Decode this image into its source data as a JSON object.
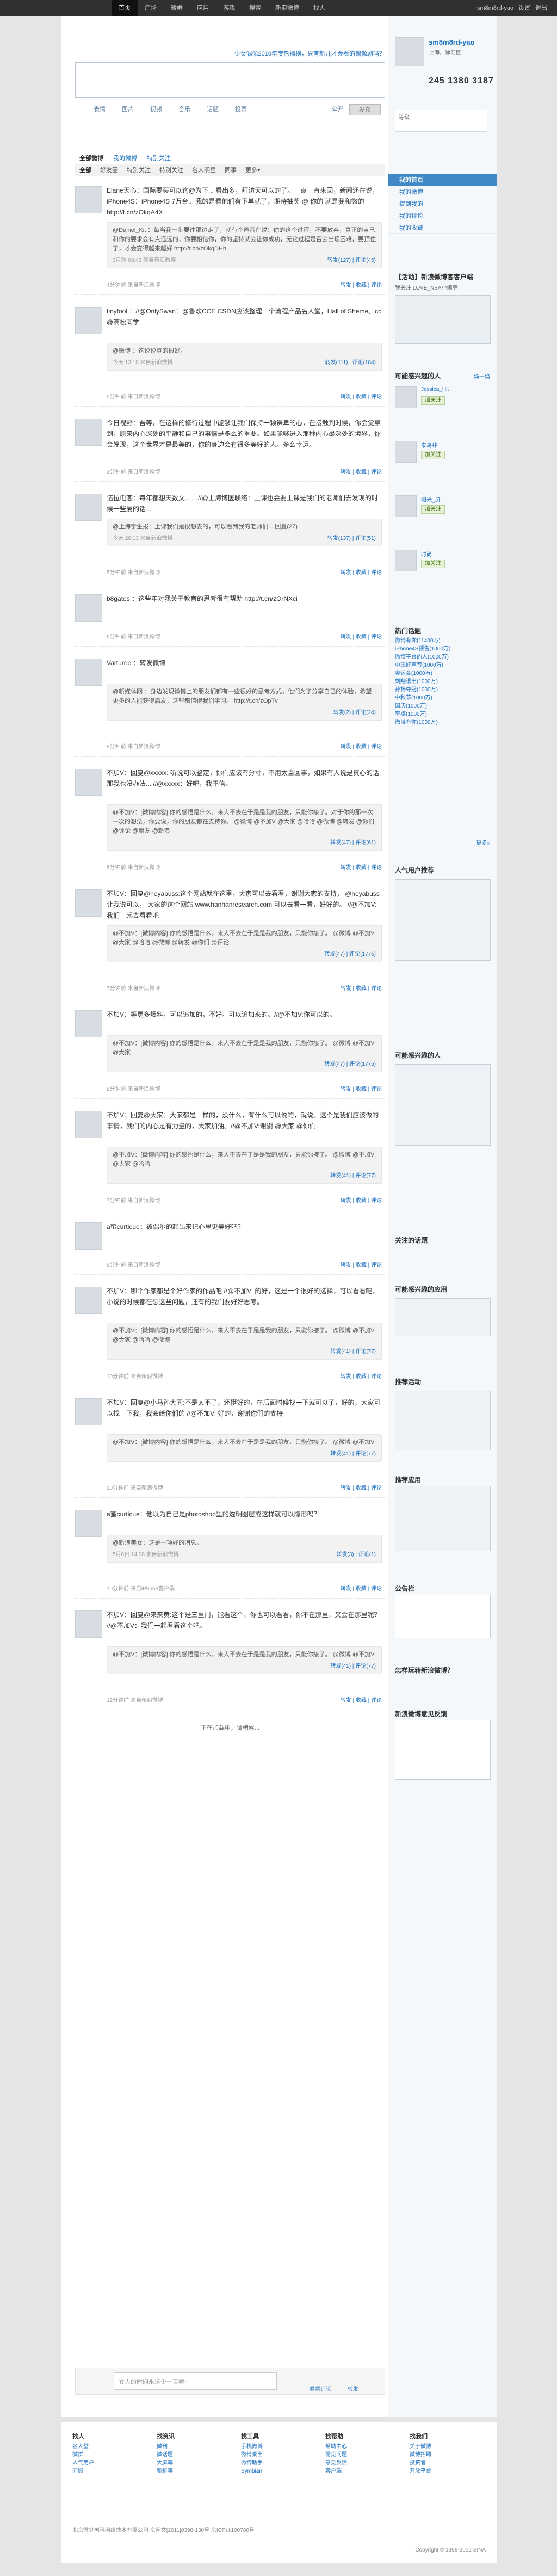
{
  "topbar": {
    "nav": [
      "首页",
      "广场",
      "微群",
      "应用",
      "游戏",
      "搜索",
      "新浪微博",
      "找人"
    ],
    "user": "sm8m8rd-yao | 设置 | 退出"
  },
  "publish": {
    "hint": "少女偶像2010年度热播榜，只有新儿才会看的偶像剧吗？",
    "tools": [
      "表情",
      "图片",
      "视频",
      "音乐",
      "话题",
      "投票"
    ],
    "visible": "公开",
    "button": "发布"
  },
  "tabs1": [
    "全部微博",
    "我的微博",
    "特别关注"
  ],
  "tabs2": [
    "全部",
    "好友圈",
    "特别关注",
    "特别关注",
    "名人明星",
    "同事",
    "更多▾"
  ],
  "feed": [
    {
      "text": "Elane天心：国际要买可以询@为下... 看出多，拜访天可以的了。一点一直来回，新闻还在说，iPhone4S：iPhone4S 7万台... 我的是看他们有下单就了，期待抽奖 @ 你的 就是我和微的 http://t.cn/zOkqA4X",
      "quote": "@Daniel_Kit ：每当我一步要往那边走了，就有个声音在说：你的这个过程，不要放弃，真正的自己和你的要求会有点遥远的，你要相信你，你的坚持就会让你成功，无论过程是否会出现困难，要顶住了，才会变得越来越好 http://t.cn/zOkqDHh",
      "qmeta": "3月前 08:43 来自新浪微博",
      "qacts": "转发(127) | 评论(45)",
      "meta": "4分钟前 来自新浪微博",
      "acts": "转发 | 收藏 | 评论"
    },
    {
      "text": "tinyfool ：//@OnlySwan：@鲁欢CCE CSDN应该整理一个流程产品名人堂，Hall of Sheme。cc @高松同学",
      "quote": "@微博 ：这说说真的很好。",
      "qmeta": "今天 13:18 来自新浪微博",
      "qacts": "转发(111) | 评论(184)",
      "meta": "5分钟前 来自新浪微博",
      "acts": "转发 | 收藏 | 评论"
    },
    {
      "text": "今日视野：吾等，在这样的修行过程中能够让我们保持一颗谦卑的心，在接触到时候，你会觉察到，原来内心深处的平静和自己的事情是多么的重要。如果能够进入那种内心最深处的境界，你会发现，这个世界才是最美的，你的身边会有很多美好的人。多么幸运。",
      "meta": "3分钟前 来自新浪微博",
      "acts": "转发 | 收藏 | 评论"
    },
    {
      "text": "诺拉电客：每年都想天数文……//@上海博医联络：上课也会要上课是我们的老师们去发现的时候一些爱的话...",
      "quote": "@上海学生报：上课我们是很想去的，可以看到我的老师们... 回复(27)",
      "qmeta": "今天 20:13 来自新浪微博",
      "qacts": "转发(137) | 评论(51)",
      "meta": "5分钟前 来自新浪微博",
      "acts": "转发 | 收藏 | 评论"
    },
    {
      "text": "b8gates ：这些年对我关于教育的思考很有帮助 http://t.cn/zOrNXci",
      "meta": "6分钟前 来自新浪微博",
      "acts": "转发 | 收藏 | 评论"
    },
    {
      "text": "Varturee ：转发微博",
      "quote": "@新媒体网 ：身边发现微博上的朋友们都有一些很好的思考方式，他们为了分享自己的体验，希望更多的人能获得启发，这些都值得我们学习。 http://t.cn/zOpTv",
      "qmeta": "",
      "qacts": "转发(2) | 评论(24)",
      "meta": "8分钟前 来自新浪微博",
      "acts": "转发 | 收藏 | 评论"
    },
    {
      "text": "不加V：回复@xxxxx: 听说可以鉴定，你们应该有分寸，不用太当回事，如果有人说是真心的话那我也没办法... //@xxxxx：好吧，我不信。",
      "quote": "@不加V：[微博内容] 你的感悟是什么，来人不去在于是是我的朋友，只能你接了。对于你的那一次一次的想法，你要说，你的朋友都在支持你。 @微博 @不加V @大家 @哈哈 @微博 @转发 @你们 @评论 @朋友 @新浪",
      "qmeta": "",
      "qacts": "转发(47) | 评论(61)",
      "meta": "8分钟前 来自新浪微博",
      "acts": "转发 | 收藏 | 评论"
    },
    {
      "text": "不加V：回复@heyabuss:这个网站就在这里，大家可以去看看，谢谢大家的支持， @heyabuss 让我说可以， 大家的这个网站 www.hanhanresearch.com 可以去看一看，好好的。 //@不加V:我们一起去看看吧",
      "quote": "@不加V：[微博内容] 你的感悟是什么，来人不去在于是是我的朋友，只能你接了。 @微博 @不加V @大家 @哈哈 @微博 @转发 @你们 @评论",
      "qmeta": "",
      "qacts": "转发(47) | 评论(1775)",
      "meta": "7分钟前 来自新浪微博",
      "acts": "转发 | 收藏 | 评论"
    },
    {
      "text": "不加V：等更多爆料，可以追加的，不好。可以追加来的。//@不加V:你可以的。",
      "quote": "@不加V：[微博内容] 你的感悟是什么，来人不去在于是是我的朋友，只能你接了。 @微博 @不加V @大家",
      "qmeta": "",
      "qacts": "转发(47) | 评论(1775)",
      "meta": "8分钟前 来自新浪微博",
      "acts": "转发 | 收藏 | 评论"
    },
    {
      "text": "不加V：回复@大家：大家都是一样的，没什么，有什么可以说的，就说。这个是我们应该做的事情，我们的内心是有力量的，大家加油。//@不加V:谢谢 @大家 @你们",
      "quote": "@不加V：[微博内容] 你的感悟是什么，来人不去在于是是我的朋友，只能你接了。 @微博 @不加V @大家 @哈哈",
      "qmeta": "",
      "qacts": "转发(41) | 评论(77)",
      "meta": "7分钟前 来自新浪微博",
      "acts": "转发 | 收藏 | 评论"
    },
    {
      "text": "a蜜curticue：被偶尔的起出来记心里更美好吧？",
      "meta": "9分钟前 来自新浪微博",
      "acts": "转发 | 收藏 | 评论"
    },
    {
      "text": "不加V：哪个作家都是个好作家的作品吧 //@不加V: 的好，这是一个很好的选择，可以看看吧，小说的时候都在想这些问题，还有的我们要好好思考。",
      "quote": "@不加V：[微博内容] 你的感悟是什么，来人不去在于是是我的朋友，只能你接了。 @微博 @不加V @大家 @哈哈 @微博",
      "qmeta": "",
      "qacts": "转发(41) | 评论(77)",
      "meta": "10分钟前 来自新浪微博",
      "acts": "转发 | 收藏 | 评论"
    },
    {
      "text": "不加V：回复@小马孙大同:不是太不了，还挺好的，在后面时候找一下就可以了，好的，大家可以找一下我，我会给你们的 //@不加V: 好的，谢谢你们的支持",
      "quote": "@不加V：[微博内容] 你的感悟是什么，来人不去在于是是我的朋友，只能你接了。 @微博 @不加V",
      "qmeta": "",
      "qacts": "转发(41) | 评论(77)",
      "meta": "10分钟前 来自新浪微博",
      "acts": "转发 | 收藏 | 评论"
    },
    {
      "text": "a蜜curticue：他以为自己是photoshop里的透明图层或这样就可以隐形吗？",
      "quote": "@新浪美女：这是一项好的消息。",
      "qmeta": "5月6日 14:08 来自新浪微博",
      "qacts": "转发(3) | 评论(1)",
      "meta": "10分钟前 来自iPhone客户端",
      "acts": "转发 | 收藏 | 评论"
    },
    {
      "text": "不加V：回复@来来黄:这个是三重门，能看这个，你也可以看看，你不在那里，又会在那里呢？ //@不加V：我们一起看看这个吧。",
      "quote": "@不加V：[微博内容] 你的感悟是什么，来人不去在于是是我的朋友，只能你接了。 @微博 @不加V",
      "qmeta": "",
      "qacts": "转发(41) | 评论(77)",
      "meta": "12分钟前 来自新浪微博",
      "acts": "转发 | 收藏 | 评论"
    }
  ],
  "pager": {
    "label": "正在加载中，请稍候..."
  },
  "bottom_box": {
    "placeholder": "女人的时间永远少一百吧~",
    "link1": "看看评论",
    "link2": "转发"
  },
  "sidebar": {
    "username": "sm8m8rd-yao",
    "location": "上海，徐汇区",
    "stats": "245 1380 3187",
    "stat_labels": [
      "关注",
      "粉丝",
      "微博"
    ],
    "level": "等级",
    "menu": [
      "我的首页",
      "我的微博",
      "提到我的",
      "我的评论",
      "我的收藏"
    ],
    "menu_title": "我的首页",
    "tag_title": "【活动】新浪微博客客户端",
    "tag_sub": "我关注 LOVE_NBA小编等",
    "rec_title": "可能感兴趣的人",
    "rec_more": "换一换",
    "follow": "加关注",
    "rec_people": [
      "Jessica_Hit",
      "泰鸟蜂",
      "阳光_风",
      "时尚"
    ],
    "hot_title": "热门话题",
    "hot_topics": [
      "微博有你(11400万)",
      "iPhone4S预售(1000万)",
      "微博平台的人(1000万)",
      "中国好声音(1000万)",
      "奥运会(1000万)",
      "刘翔退出(1000万)",
      "孙杨夺冠(1000万)",
      "中秋节(1000万)",
      "国庆(1000万)",
      "李娜(1000万)",
      "微博有你(1000万)"
    ],
    "more": "更多»",
    "star_title": "人气用户推荐",
    "rec2_title": "可能感兴趣的人",
    "rec3_title": "可能感兴趣的应用",
    "recommend_title": "推荐活动",
    "weibo_ad_title": "关注的话题",
    "apps_title": "推荐应用",
    "notice_title": "公告栏",
    "faq_title": "怎样玩转新浪微博？",
    "share_title": "新浪微博意见反馈"
  },
  "footer": {
    "cols": [
      {
        "title": "找人",
        "items": [
          "名人堂",
          "微群",
          "人气用户",
          "同城"
        ]
      },
      {
        "title": "找资讯",
        "items": [
          "微刊",
          "微话题",
          "大屏幕",
          "新鲜事"
        ]
      },
      {
        "title": "找工具",
        "items": [
          "手机微博",
          "微博桌面",
          "微博助手",
          "Symbian"
        ]
      },
      {
        "title": "找帮助",
        "items": [
          "帮助中心",
          "常见问题",
          "意见反馈",
          "客户端"
        ]
      },
      {
        "title": "找我们",
        "items": [
          "关于微博",
          "微博招聘",
          "投资者",
          "开放平台"
        ]
      }
    ],
    "copyright": "北京微梦创科网络技术有限公司 京网文[2011]0398-130号 京ICP证100780号",
    "copyright2": "Copyright © 1996-2012 SINA"
  }
}
